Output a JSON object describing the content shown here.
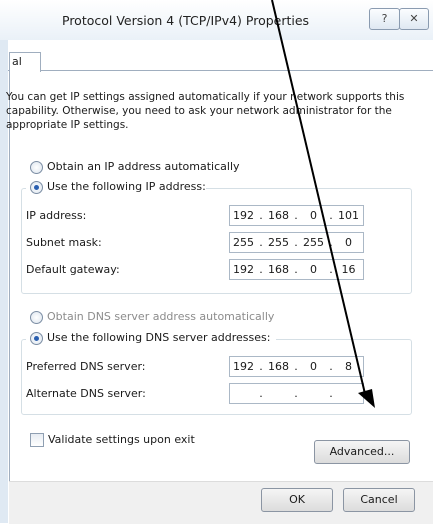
{
  "window": {
    "title": "Protocol Version 4 (TCP/IPv4) Properties",
    "help_glyph": "?",
    "close_glyph": "✕"
  },
  "tabs": [
    "al"
  ],
  "intro_text": "You can get IP settings assigned automatically if your network supports this capability. Otherwise, you need to ask your network administrator for the appropriate IP settings.",
  "ip_section": {
    "obtain_auto_label": "Obtain an IP address automatically",
    "use_following_label": "Use the following IP address:",
    "selected": "use_following",
    "fields": [
      {
        "label": "IP address:",
        "octets": [
          "192",
          "168",
          "0",
          "101"
        ]
      },
      {
        "label": "Subnet mask:",
        "octets": [
          "255",
          "255",
          "255",
          "0"
        ]
      },
      {
        "label": "Default gateway:",
        "octets": [
          "192",
          "168",
          "0",
          "16"
        ]
      }
    ]
  },
  "dns_section": {
    "obtain_auto_label": "Obtain DNS server address automatically",
    "use_following_label": "Use the following DNS server addresses:",
    "selected": "use_following",
    "fields": [
      {
        "label": "Preferred DNS server:",
        "octets": [
          "192",
          "168",
          "0",
          "8"
        ]
      },
      {
        "label": "Alternate DNS server:",
        "octets": [
          "",
          "",
          "",
          ""
        ]
      }
    ]
  },
  "validate_label": "Validate settings upon exit",
  "validate_checked": false,
  "buttons": {
    "advanced": "Advanced...",
    "ok": "OK",
    "cancel": "Cancel"
  },
  "annotation_color": "#000000"
}
